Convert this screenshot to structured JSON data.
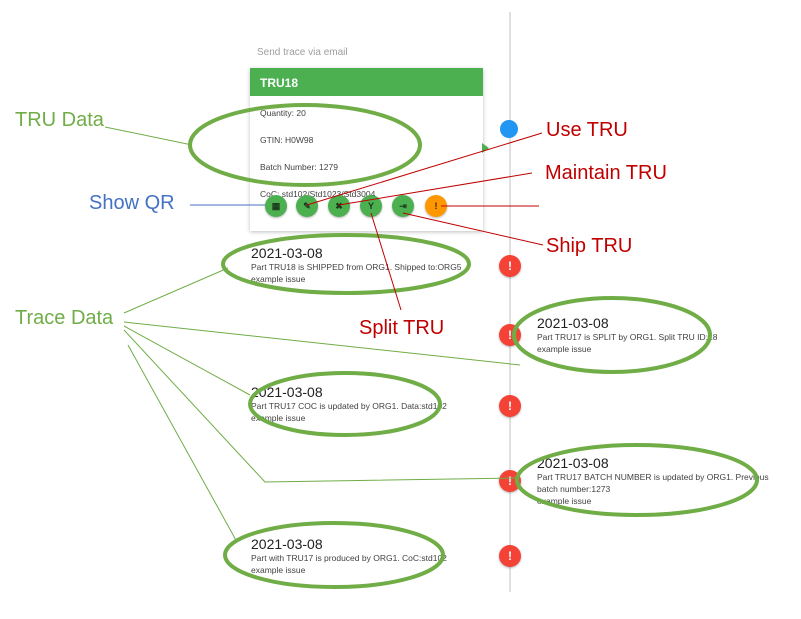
{
  "send_trace": "Send trace via email",
  "card": {
    "title": "TRU18",
    "quantity": "Quantity: 20",
    "gtin": "GTIN: H0W98",
    "batch": "Batch Number: 1279",
    "coc": "CoC: std102/Std1023/Std3004"
  },
  "actions": [
    {
      "icon": "qr-code-icon",
      "glyph": "▦"
    },
    {
      "icon": "edit-note-icon",
      "glyph": "✎"
    },
    {
      "icon": "tools-icon",
      "glyph": "✖"
    },
    {
      "icon": "split-icon",
      "glyph": "Y"
    },
    {
      "icon": "ship-exit-icon",
      "glyph": "⇥"
    },
    {
      "icon": "alert-icon",
      "glyph": "!"
    }
  ],
  "trace_events": [
    {
      "date": "2021-03-08",
      "desc": "Part TRU18 is SHIPPED from ORG1. Shipped to:ORG5",
      "note": "example issue"
    },
    {
      "date": "2021-03-08",
      "desc": "Part TRU17 is SPLIT by ORG1. Split TRU ID:18",
      "note": "example issue"
    },
    {
      "date": "2021-03-08",
      "desc": "Part TRU17 COC is updated by ORG1. Data:std102",
      "note": "example issue"
    },
    {
      "date": "2021-03-08",
      "desc": "Part TRU17 BATCH NUMBER is updated by ORG1. Previous",
      "desc2": "batch number:1273",
      "note": "example issue"
    },
    {
      "date": "2021-03-08",
      "desc": "Part with TRU17 is produced by ORG1. CoC:std102",
      "note": "example issue"
    }
  ],
  "alert_glyph": "!",
  "annotations": {
    "tru_data": "TRU Data",
    "show_qr": "Show QR",
    "trace_data": "Trace Data",
    "use_tru": "Use TRU",
    "maintain_tru": "Maintain TRU",
    "ship_tru": "Ship TRU",
    "split_tru": "Split TRU"
  },
  "colors": {
    "card_header": "#4caf50",
    "action_green": "#4caf50",
    "action_warn": "#ff9800",
    "alert_red": "#f44336",
    "current_dot": "#2196f3",
    "annotation_green": "#70ad47",
    "annotation_blue": "#4472c4",
    "annotation_red": "#c00000"
  }
}
